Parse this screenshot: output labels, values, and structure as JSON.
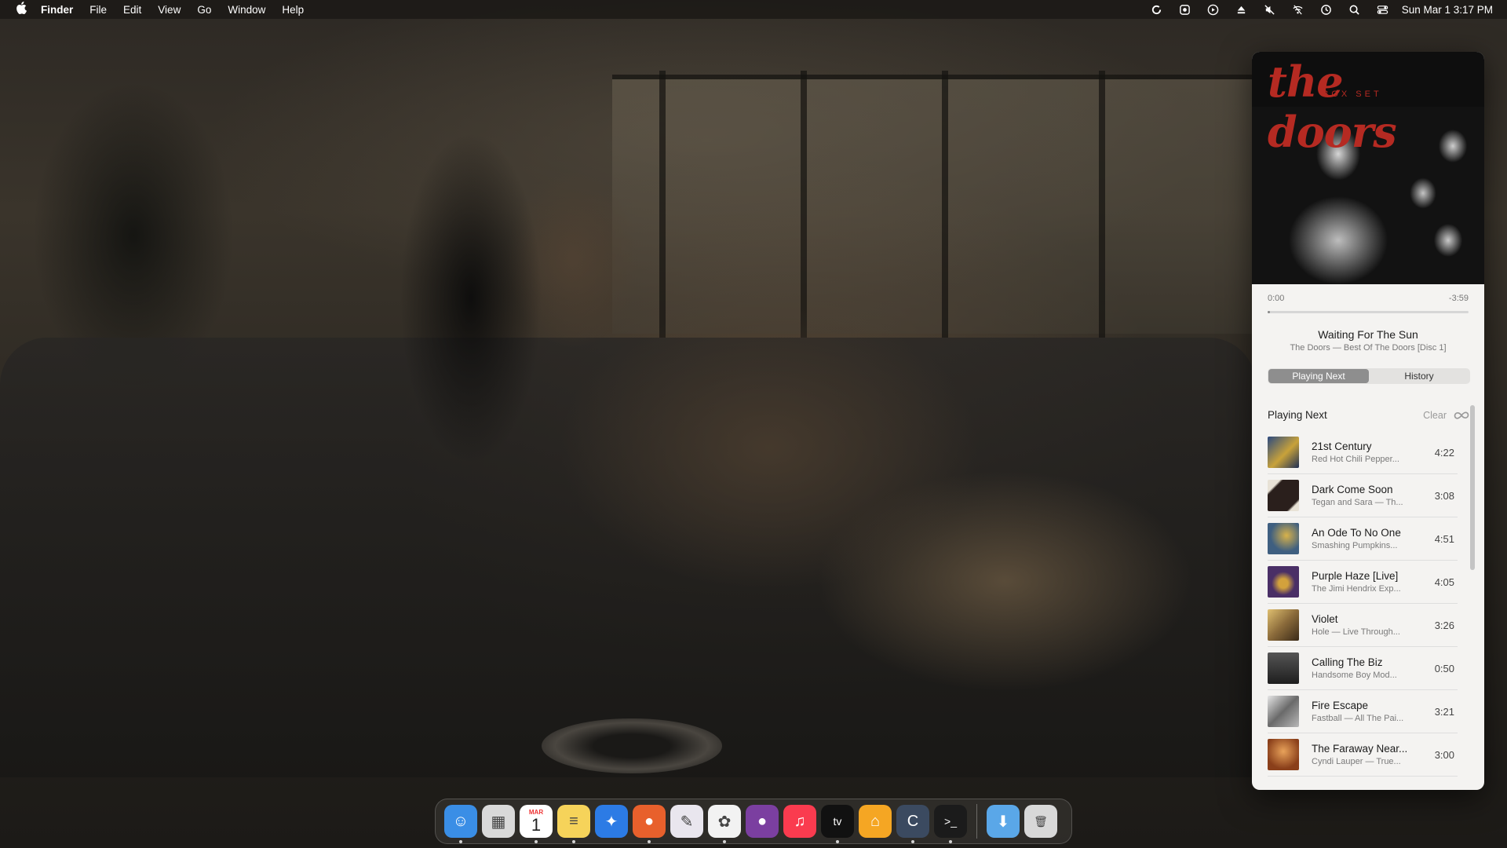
{
  "menubar": {
    "apple_icon": "apple-icon",
    "app_name": "Finder",
    "menus": [
      "File",
      "Edit",
      "View",
      "Go",
      "Window",
      "Help"
    ],
    "status_icons": [
      "sync-icon",
      "screenshot-icon",
      "play-circle-icon",
      "eject-icon",
      "mute-icon",
      "wifi-off-icon",
      "time-machine-icon",
      "search-icon",
      "control-center-icon"
    ],
    "clock": "Sun Mar 1  3:17 PM"
  },
  "player": {
    "album_art_text": "the doors",
    "album_art_subtext": "BOX SET",
    "elapsed": "0:00",
    "remaining": "-3:59",
    "progress": 0.01,
    "track_title": "Waiting For The Sun",
    "track_subtitle": "The Doors — Best Of The Doors [Disc 1]",
    "tabs": [
      {
        "label": "Playing Next",
        "active": true
      },
      {
        "label": "History",
        "active": false
      }
    ],
    "queue_heading": "Playing Next",
    "clear_label": "Clear",
    "autoplay_icon": "infinity-icon",
    "queue": [
      {
        "title": "21st Century",
        "subtitle": "Red Hot Chili Pepper...",
        "duration": "4:22",
        "art": "#3b5a8f"
      },
      {
        "title": "Dark Come Soon",
        "subtitle": "Tegan and Sara — Th...",
        "duration": "3:08",
        "art": "#2a1f1c"
      },
      {
        "title": "An Ode To No One",
        "subtitle": "Smashing Pumpkins...",
        "duration": "4:51",
        "art": "#4b6a8a"
      },
      {
        "title": "Purple Haze [Live]",
        "subtitle": "The Jimi Hendrix Exp...",
        "duration": "4:05",
        "art": "#4a2f66"
      },
      {
        "title": "Violet",
        "subtitle": "Hole — Live Through...",
        "duration": "3:26",
        "art": "#8a6a3a"
      },
      {
        "title": "Calling The Biz",
        "subtitle": "Handsome Boy Mod...",
        "duration": "0:50",
        "art": "#2e2e2e"
      },
      {
        "title": "Fire Escape",
        "subtitle": "Fastball — All The Pai...",
        "duration": "3:21",
        "art": "#7a7a7a"
      },
      {
        "title": "The Faraway Near...",
        "subtitle": "Cyndi Lauper — True...",
        "duration": "3:00",
        "art": "#b0642a"
      }
    ]
  },
  "dock": {
    "apps": [
      {
        "name": "finder-icon",
        "color": "#3a8ee6",
        "glyph": "☺",
        "running": true
      },
      {
        "name": "launchpad-icon",
        "color": "#d9d9d9",
        "glyph": "▦",
        "running": false
      },
      {
        "name": "calendar-icon",
        "color": "#ffffff",
        "glyph": "1",
        "running": true
      },
      {
        "name": "notes-icon",
        "color": "#f6d35a",
        "glyph": "≡",
        "running": true
      },
      {
        "name": "safari-icon",
        "color": "#2c7be5",
        "glyph": "✦",
        "running": false
      },
      {
        "name": "firefox-icon",
        "color": "#e8602c",
        "glyph": "●",
        "running": true
      },
      {
        "name": "pixelmator-icon",
        "color": "#e9e6ee",
        "glyph": "✎",
        "running": false
      },
      {
        "name": "photos-icon",
        "color": "#f2f2f2",
        "glyph": "✿",
        "running": true
      },
      {
        "name": "firefox-nightly-icon",
        "color": "#7b3fa0",
        "glyph": "●",
        "running": false
      },
      {
        "name": "music-icon",
        "color": "#fa3b4f",
        "glyph": "♫",
        "running": false
      },
      {
        "name": "apple-tv-icon",
        "color": "#111111",
        "glyph": "tv",
        "running": true
      },
      {
        "name": "home-icon",
        "color": "#f5a623",
        "glyph": "⌂",
        "running": false
      },
      {
        "name": "chrome-canary-icon",
        "color": "#3b4a60",
        "glyph": "C",
        "running": true
      },
      {
        "name": "terminal-icon",
        "color": "#1b1b1b",
        "glyph": ">_",
        "running": true
      },
      {
        "name": "downloads-folder-icon",
        "color": "#5aa7e8",
        "glyph": "⬇",
        "running": false
      },
      {
        "name": "trash-icon",
        "color": "#d8d8d8",
        "glyph": "🗑",
        "running": false
      }
    ],
    "calendar_month": "MAR"
  }
}
